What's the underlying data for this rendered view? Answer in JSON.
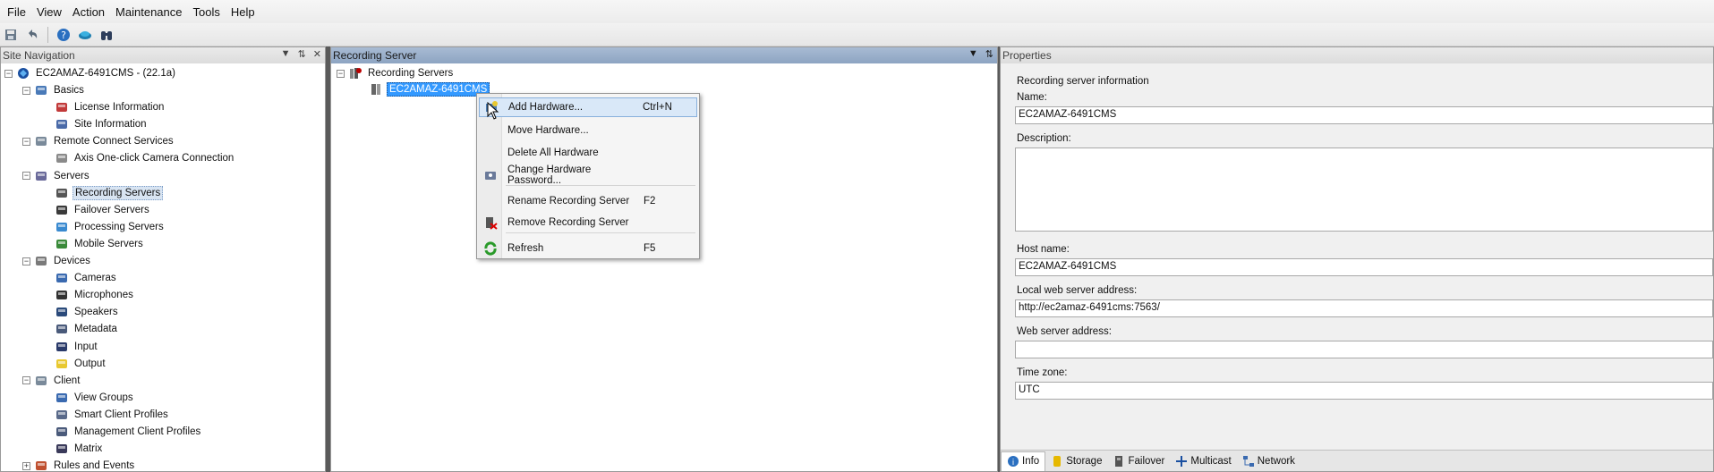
{
  "menu": [
    "File",
    "View",
    "Action",
    "Maintenance",
    "Tools",
    "Help"
  ],
  "toolbar": {
    "icons": [
      "save-icon",
      "undo-icon",
      "help-icon",
      "network-icon",
      "binoculars-icon"
    ]
  },
  "site_nav": {
    "title": "Site Navigation",
    "pin": "⬍",
    "close": "✕",
    "root": "EC2AMAZ-6491CMS - (22.1a)",
    "items": [
      {
        "label": "Basics",
        "level": 1,
        "icon": "book-icon",
        "expander": "−"
      },
      {
        "label": "License Information",
        "level": 2,
        "icon": "license-icon"
      },
      {
        "label": "Site Information",
        "level": 2,
        "icon": "site-info-icon"
      },
      {
        "label": "Remote Connect Services",
        "level": 1,
        "icon": "remote-icon",
        "expander": "−"
      },
      {
        "label": "Axis One-click Camera Connection",
        "level": 2,
        "icon": "camera-connection-icon"
      },
      {
        "label": "Servers",
        "level": 1,
        "icon": "servers-icon",
        "expander": "−"
      },
      {
        "label": "Recording Servers",
        "level": 2,
        "icon": "recording-server-icon",
        "selected": true
      },
      {
        "label": "Failover Servers",
        "level": 2,
        "icon": "failover-icon"
      },
      {
        "label": "Processing Servers",
        "level": 2,
        "icon": "processing-icon"
      },
      {
        "label": "Mobile Servers",
        "level": 2,
        "icon": "mobile-icon"
      },
      {
        "label": "Devices",
        "level": 1,
        "icon": "devices-icon",
        "expander": "−"
      },
      {
        "label": "Cameras",
        "level": 2,
        "icon": "camera-icon"
      },
      {
        "label": "Microphones",
        "level": 2,
        "icon": "microphone-icon"
      },
      {
        "label": "Speakers",
        "level": 2,
        "icon": "speaker-icon"
      },
      {
        "label": "Metadata",
        "level": 2,
        "icon": "metadata-icon"
      },
      {
        "label": "Input",
        "level": 2,
        "icon": "input-icon"
      },
      {
        "label": "Output",
        "level": 2,
        "icon": "output-icon"
      },
      {
        "label": "Client",
        "level": 1,
        "icon": "client-icon",
        "expander": "−"
      },
      {
        "label": "View Groups",
        "level": 2,
        "icon": "view-groups-icon"
      },
      {
        "label": "Smart Client Profiles",
        "level": 2,
        "icon": "smart-client-icon"
      },
      {
        "label": "Management Client Profiles",
        "level": 2,
        "icon": "management-client-icon"
      },
      {
        "label": "Matrix",
        "level": 2,
        "icon": "matrix-icon"
      },
      {
        "label": "Rules and Events",
        "level": 1,
        "icon": "rules-icon",
        "expander": "+"
      }
    ]
  },
  "recording_panel": {
    "title": "Recording Server",
    "tree_root": "Recording Servers",
    "tree_child": "EC2AMAZ-6491CMS",
    "context_menu": [
      {
        "label": "Add Hardware...",
        "shortcut": "Ctrl+N",
        "icon": "add-hardware-icon",
        "hover": true
      },
      {
        "label": "Move Hardware...",
        "shortcut": "",
        "icon": ""
      },
      {
        "label": "Delete All Hardware",
        "shortcut": "",
        "icon": ""
      },
      {
        "label": "Change Hardware Password...",
        "shortcut": "",
        "icon": "password-icon"
      },
      {
        "label": "Rename Recording Server",
        "shortcut": "F2",
        "icon": ""
      },
      {
        "label": "Remove Recording Server",
        "shortcut": "",
        "icon": "remove-server-icon"
      },
      {
        "label": "Refresh",
        "shortcut": "F5",
        "icon": "refresh-icon"
      }
    ]
  },
  "properties": {
    "title": "Properties",
    "section": "Recording server information",
    "name_label": "Name:",
    "name_value": "EC2AMAZ-6491CMS",
    "description_label": "Description:",
    "description_value": "",
    "host_label": "Host name:",
    "host_value": "EC2AMAZ-6491CMS",
    "local_web_label": "Local web server address:",
    "local_web_value": "http://ec2amaz-6491cms:7563/",
    "web_label": "Web server address:",
    "web_value": "",
    "tz_label": "Time zone:",
    "tz_value": "UTC",
    "tabs": [
      "Info",
      "Storage",
      "Failover",
      "Multicast",
      "Network"
    ]
  }
}
